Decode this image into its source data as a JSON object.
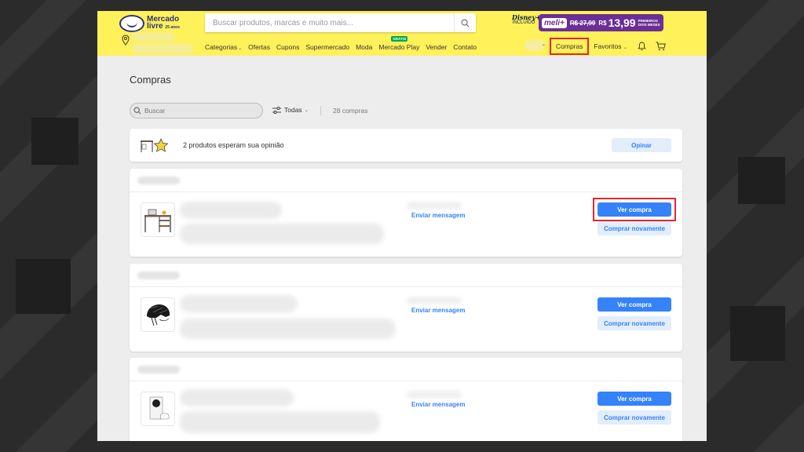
{
  "header": {
    "logo_line1": "Mercado",
    "logo_line2": "livre",
    "logo_sub": "25 anos",
    "search_placeholder": "Buscar produtos, marcas e muito mais...",
    "disney_label": "Disney+",
    "disney_sub": "INCLUÍDO",
    "meli_tag": "meli+",
    "meli_old_price": "R$ 27,99",
    "meli_currency": "R$",
    "meli_new_price": "13,99",
    "meli_promo_line1": "PRIMEIROS",
    "meli_promo_line2": "DOIS MESES",
    "nav": [
      {
        "label": "Categorias",
        "chevron": true
      },
      {
        "label": "Ofertas"
      },
      {
        "label": "Cupons"
      },
      {
        "label": "Supermercado"
      },
      {
        "label": "Moda"
      },
      {
        "label": "Mercado Play",
        "badge": "GRÁTIS"
      },
      {
        "label": "Vender"
      },
      {
        "label": "Contato"
      }
    ],
    "compras_label": "Compras",
    "favoritos_label": "Favoritos"
  },
  "page": {
    "title": "Compras",
    "filter_placeholder": "Buscar",
    "filter_todos": "Todas",
    "count_label": "28 compras"
  },
  "review": {
    "text": "2 produtos esperam sua opinião",
    "button": "Opinar"
  },
  "purchases": [
    {
      "product": "desk",
      "message_link": "Enviar mensagem",
      "view_button": "Ver compra",
      "rebuy_button": "Comprar novamente"
    },
    {
      "product": "helmet",
      "message_link": "Enviar mensagem",
      "view_button": "Ver compra",
      "rebuy_button": "Comprar novamente"
    },
    {
      "product": "console",
      "message_link": "Enviar mensagem",
      "view_button": "Ver compra",
      "rebuy_button": "Comprar novamente"
    }
  ],
  "colors": {
    "header_bg": "#fff159",
    "primary": "#3483fa",
    "highlight": "#e5262b",
    "meli_purple": "#6b2e96"
  },
  "icons": [
    "search-icon",
    "location-pin-icon",
    "bell-icon",
    "cart-icon",
    "filter-sliders-icon",
    "chevron-down-icon"
  ]
}
